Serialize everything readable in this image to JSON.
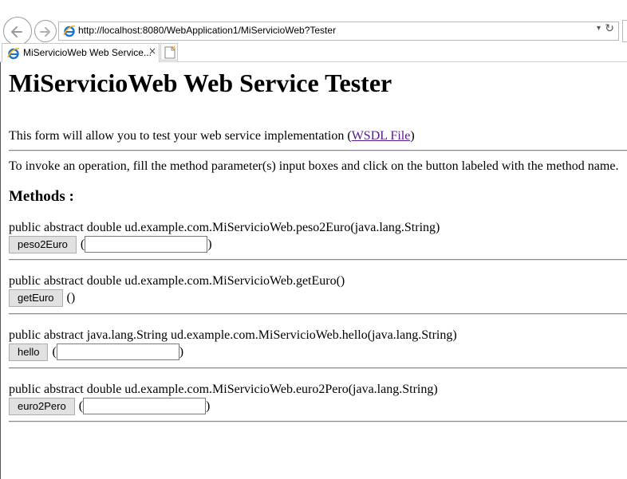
{
  "browser": {
    "url": "http://localhost:8080/WebApplication1/MiServicioWeb?Tester",
    "tab_title": "MiServicioWeb Web Service...",
    "tab_close": "×",
    "address_dropdown_glyph": "▾",
    "address_refresh_glyph": "↻",
    "icons": [
      "back-arrow-icon",
      "forward-arrow-icon",
      "ie-logo-icon",
      "dropdown-icon",
      "refresh-icon",
      "close-icon",
      "new-tab-icon"
    ]
  },
  "page": {
    "title": "MiServicioWeb Web Service Tester",
    "intro_text": "This form will allow you to test your web service implementation (",
    "intro_link": "WSDL File",
    "intro_close": ")",
    "instructions": "To invoke an operation, fill the method parameter(s) input boxes and click on the button labeled with the method name.",
    "methods_heading": "Methods :",
    "methods": [
      {
        "signature": "public abstract double ud.example.com.MiServicioWeb.peso2Euro(java.lang.String)",
        "button_label": "peso2Euro",
        "open_paren": "(",
        "close_paren": ")",
        "input_value": ""
      },
      {
        "signature": "public abstract double ud.example.com.MiServicioWeb.getEuro()",
        "button_label": "getEuro",
        "empty_parens": "()"
      },
      {
        "signature": "public abstract java.lang.String ud.example.com.MiServicioWeb.hello(java.lang.String)",
        "button_label": "hello",
        "open_paren": "(",
        "close_paren": ")",
        "input_value": ""
      },
      {
        "signature": "public abstract double ud.example.com.MiServicioWeb.euro2Pero(java.lang.String)",
        "button_label": "euro2Pero",
        "open_paren": "(",
        "close_paren": ")",
        "input_value": ""
      }
    ]
  },
  "colors": {
    "link_visited": "#551a8b",
    "button_bg": "#e1e1e1",
    "ie_blue": "#1e73c8"
  }
}
